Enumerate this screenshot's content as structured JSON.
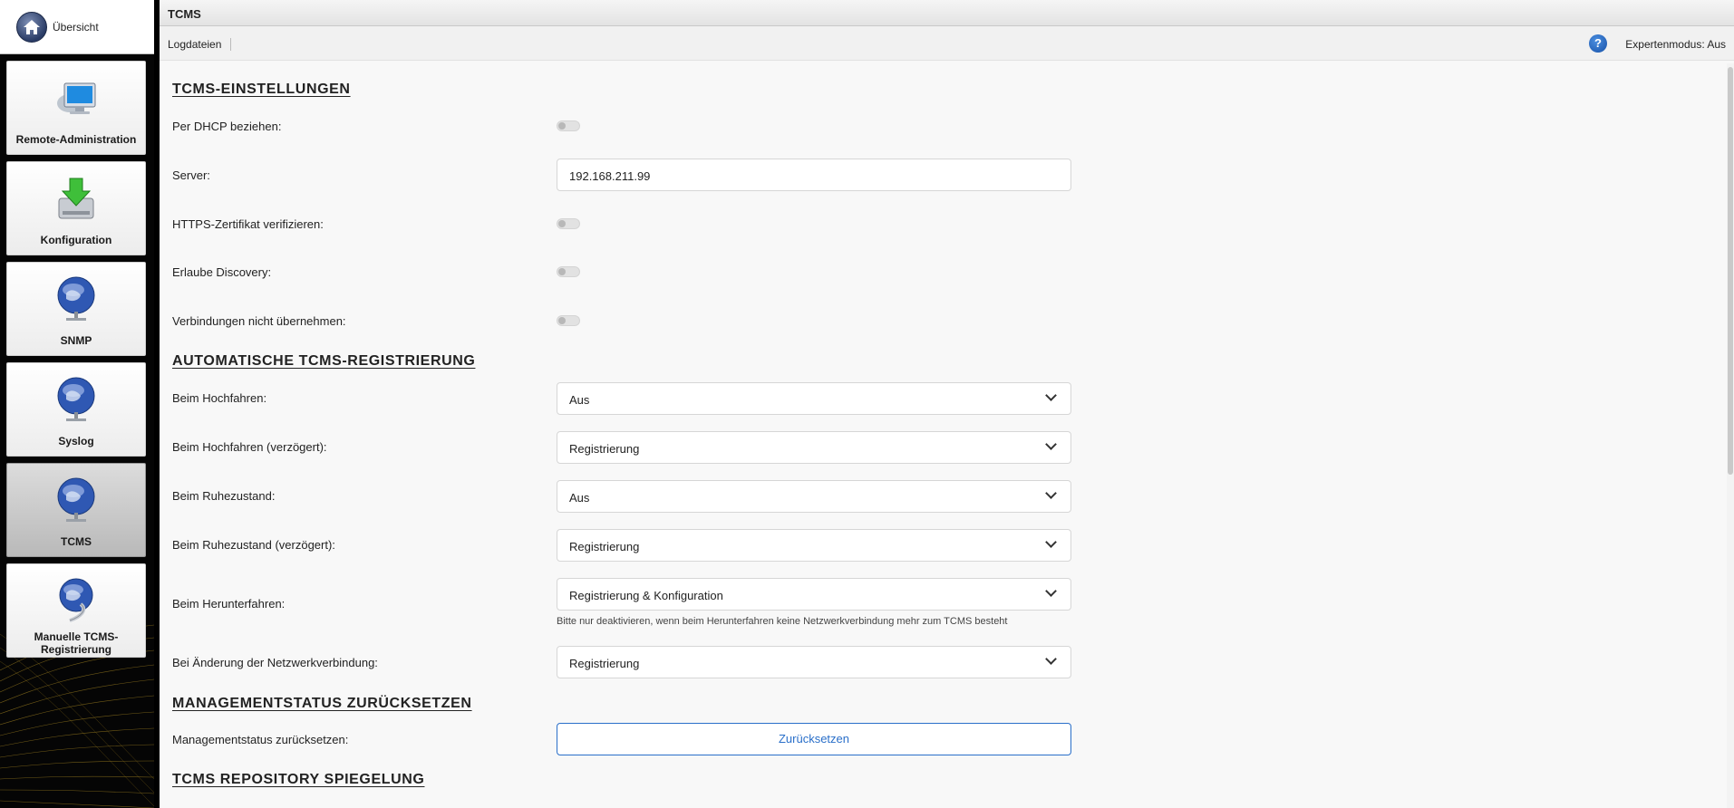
{
  "sidebar": {
    "overview_label": "Übersicht",
    "tiles": [
      {
        "label": "Remote-Administration",
        "icon": "monitor-icon"
      },
      {
        "label": "Konfiguration",
        "icon": "download-drive-icon"
      },
      {
        "label": "SNMP",
        "icon": "globe-icon"
      },
      {
        "label": "Syslog",
        "icon": "globe-icon"
      },
      {
        "label": "TCMS",
        "icon": "globe-icon",
        "active": true
      },
      {
        "label": "Manuelle TCMS-Registrierung",
        "icon": "globe-cable-icon"
      }
    ]
  },
  "header": {
    "title": "TCMS",
    "logs_label": "Logdateien",
    "help_glyph": "?",
    "expert_mode": "Expertenmodus: Aus"
  },
  "sections": {
    "tcms_settings": {
      "title": "TCMS-EINSTELLUNGEN",
      "dhcp_label": "Per DHCP beziehen:",
      "server_label": "Server:",
      "server_value": "192.168.211.99",
      "https_label": "HTTPS-Zertifikat verifizieren:",
      "discovery_label": "Erlaube Discovery:",
      "connections_label": "Verbindungen nicht übernehmen:"
    },
    "auto_registration": {
      "title": "AUTOMATISCHE TCMS-REGISTRIERUNG",
      "rows": [
        {
          "label": "Beim Hochfahren:",
          "value": "Aus"
        },
        {
          "label": "Beim Hochfahren (verzögert):",
          "value": "Registrierung"
        },
        {
          "label": "Beim Ruhezustand:",
          "value": "Aus"
        },
        {
          "label": "Beim Ruhezustand (verzögert):",
          "value": "Registrierung"
        },
        {
          "label": "Beim Herunterfahren:",
          "value": "Registrierung & Konfiguration"
        },
        {
          "label": "Bei Änderung der Netzwerkverbindung:",
          "value": "Registrierung"
        }
      ],
      "shutdown_hint": "Bitte nur deaktivieren, wenn beim Herunterfahren keine Netzwerkverbindung mehr zum TCMS besteht"
    },
    "reset": {
      "title": "MANAGEMENTSTATUS ZURÜCKSETZEN",
      "label": "Managementstatus zurücksetzen:",
      "button": "Zurücksetzen"
    },
    "mirror": {
      "title": "TCMS REPOSITORY SPIEGELUNG"
    }
  },
  "colors": {
    "accent": "#2a6fc9",
    "sidebar_bg": "#050505",
    "wave": "#c9a227"
  }
}
